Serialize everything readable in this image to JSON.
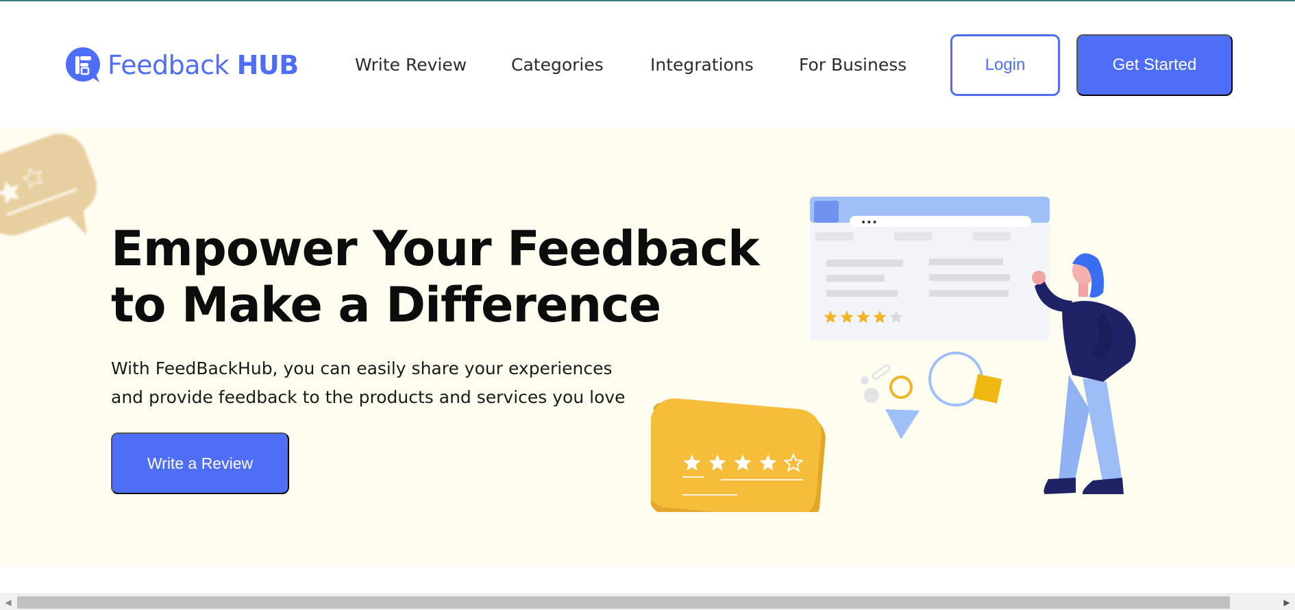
{
  "brand": {
    "name_part1": "Feedback",
    "name_part2": "HUB",
    "color": "#4f6ef7"
  },
  "nav": {
    "items": [
      {
        "label": "Write Review"
      },
      {
        "label": "Categories"
      },
      {
        "label": "Integrations"
      },
      {
        "label": "For Business"
      }
    ]
  },
  "header": {
    "login_label": "Login",
    "get_started_label": "Get Started"
  },
  "hero": {
    "title_line1": "Empower Your Feedback",
    "title_line2": "to Make a Difference",
    "desc_line1": "With FeedBackHub, you can easily share your experiences",
    "desc_line2": "and provide feedback to the products and services you love",
    "cta_label": "Write a Review",
    "background": "#fefdf0"
  },
  "illustration": {
    "browser_dots": "•••",
    "browser_rating_stars": 4,
    "bubble_rating_stars": 4,
    "max_stars": 5
  },
  "icons": {
    "logo": "logo-icon",
    "scroll_left": "chevron-left-icon",
    "scroll_right": "chevron-right-icon"
  },
  "colors": {
    "accent": "#4f6ef7",
    "star": "#f0b323",
    "person_dark": "#1f2366",
    "person_light": "#9bbcf5"
  }
}
